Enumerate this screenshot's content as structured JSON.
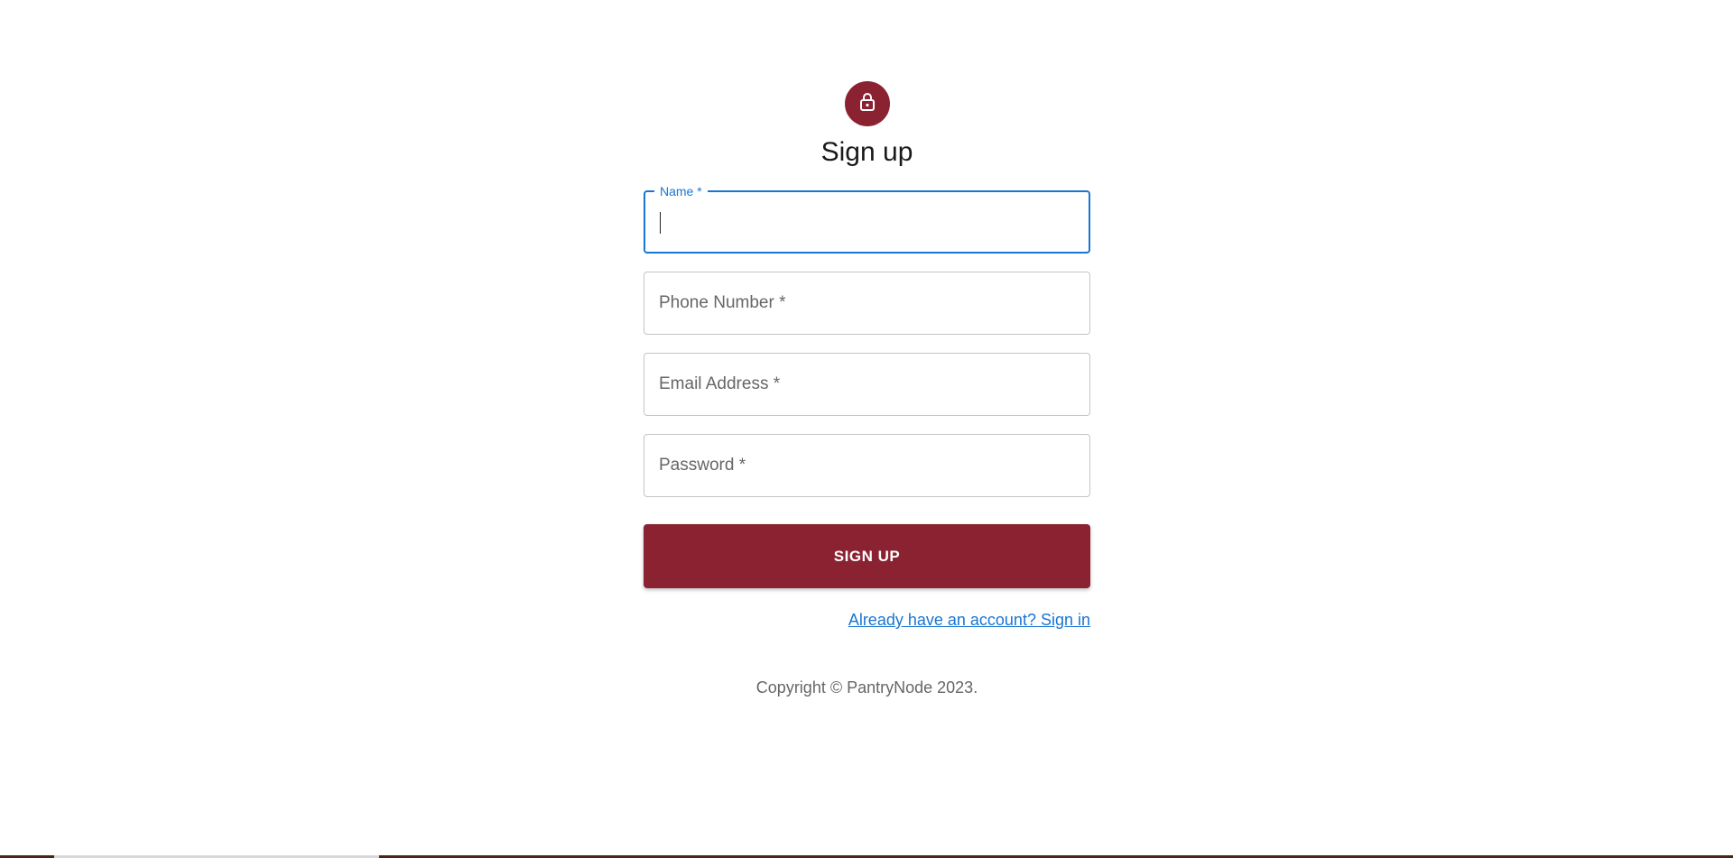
{
  "header": {
    "title": "Sign up",
    "icon": "lock-icon",
    "icon_color": "#8b2232"
  },
  "form": {
    "name_label": "Name *",
    "name_value": "",
    "phone_label": "Phone Number *",
    "email_label": "Email Address *",
    "password_label": "Password *",
    "submit_label": "SIGN UP",
    "signin_link": "Already have an account? Sign in"
  },
  "footer": {
    "copyright": "Copyright © PantryNode 2023."
  },
  "colors": {
    "brand": "#8b2232",
    "focus": "#1976d2",
    "link": "#1976d2"
  }
}
